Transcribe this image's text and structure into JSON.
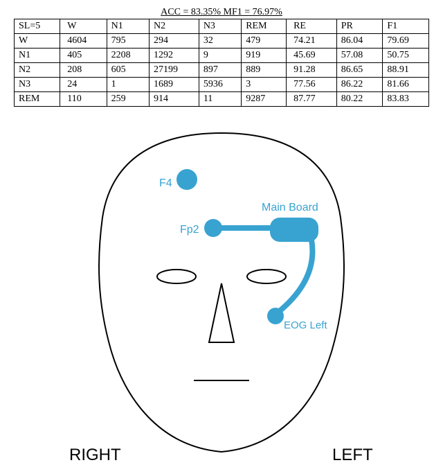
{
  "header": "ACC = 83.35% MF1 = 76.97%",
  "table": {
    "head": [
      "SL=5",
      "W",
      "N1",
      "N2",
      "N3",
      "REM",
      "RE",
      "PR",
      "F1"
    ],
    "rows": [
      {
        "label": "W",
        "c": [
          "4604",
          "795",
          "294",
          "32",
          "479"
        ],
        "m": [
          "74.21",
          "86.04",
          "79.69"
        ]
      },
      {
        "label": "N1",
        "c": [
          "405",
          "2208",
          "1292",
          "9",
          "919"
        ],
        "m": [
          "45.69",
          "57.08",
          "50.75"
        ]
      },
      {
        "label": "N2",
        "c": [
          "208",
          "605",
          "27199",
          "897",
          "889"
        ],
        "m": [
          "91.28",
          "86.65",
          "88.91"
        ]
      },
      {
        "label": "N3",
        "c": [
          "24",
          "1",
          "1689",
          "5936",
          "3"
        ],
        "m": [
          "77.56",
          "86.22",
          "81.66"
        ]
      },
      {
        "label": "REM",
        "c": [
          "110",
          "259",
          "914",
          "11",
          "9287"
        ],
        "m": [
          "87.77",
          "80.22",
          "83.83"
        ]
      }
    ]
  },
  "diagram": {
    "f4": "F4",
    "fp2": "Fp2",
    "main_board": "Main Board",
    "eog_left": "EOG Left",
    "right": "RIGHT",
    "left": "LEFT"
  }
}
